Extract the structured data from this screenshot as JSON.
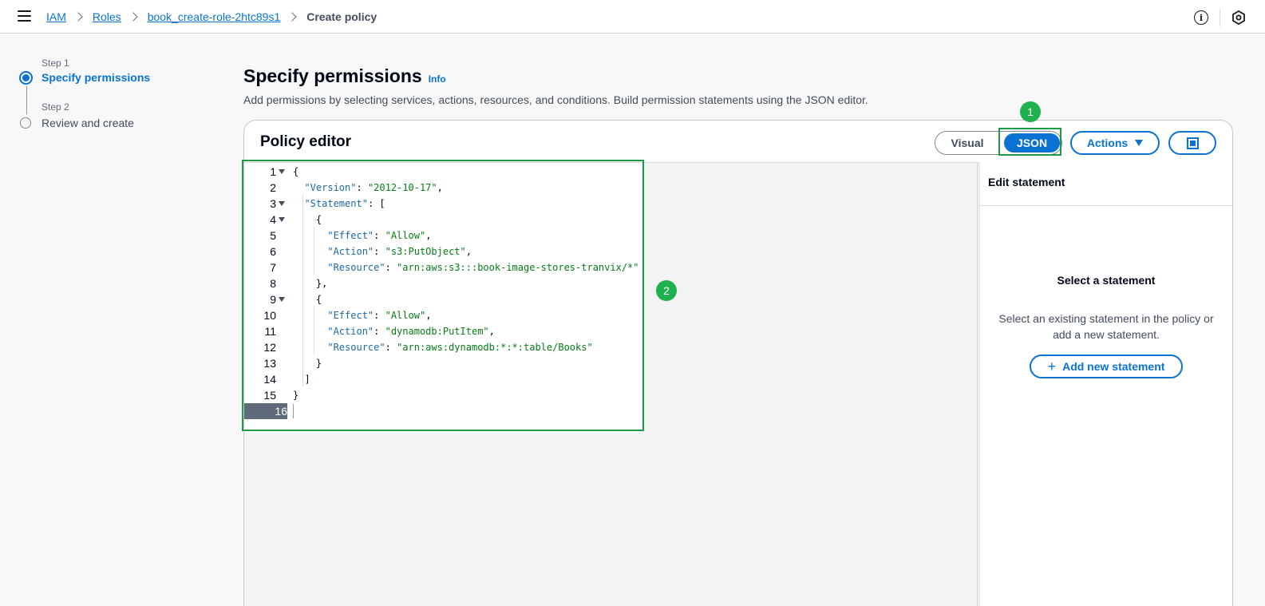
{
  "breadcrumb": {
    "items": [
      "IAM",
      "Roles",
      "book_create-role-2htc89s1"
    ],
    "current": "Create policy"
  },
  "steps": [
    {
      "number": "Step 1",
      "label": "Specify permissions"
    },
    {
      "number": "Step 2",
      "label": "Review and create"
    }
  ],
  "page": {
    "title": "Specify permissions",
    "info": "Info",
    "description": "Add permissions by selecting services, actions, resources, and conditions. Build permission statements using the JSON editor."
  },
  "editor": {
    "title": "Policy editor",
    "mode_visual": "Visual",
    "mode_json": "JSON",
    "actions_label": "Actions",
    "line_numbers": [
      "1",
      "2",
      "3",
      "4",
      "5",
      "6",
      "7",
      "8",
      "9",
      "10",
      "11",
      "12",
      "13",
      "14",
      "15",
      "16"
    ],
    "active_line": "16"
  },
  "policy": {
    "version_key": "\"Version\"",
    "version_val": "\"2012-10-17\"",
    "statement_key": "\"Statement\"",
    "effect_key": "\"Effect\"",
    "action_key": "\"Action\"",
    "resource_key": "\"Resource\"",
    "s1_effect": "\"Allow\"",
    "s1_action": "\"s3:PutObject\"",
    "s1_resource": "\"arn:aws:s3:::book-image-stores-tranvix/*\"",
    "s2_effect": "\"Allow\"",
    "s2_action": "\"dynamodb:PutItem\"",
    "s2_resource": "\"arn:aws:dynamodb:*:*:table/Books\""
  },
  "side_panel": {
    "header": "Edit statement",
    "title": "Select a statement",
    "description": "Select an existing statement in the policy or add a new statement.",
    "add_button": "Add new statement"
  },
  "annotations": {
    "one": "1",
    "two": "2"
  },
  "colors": {
    "accent": "#0972d3",
    "annotation": "#1fb04f"
  },
  "icons": [
    "menu-icon",
    "info-circle-icon",
    "hexagon-settings-icon",
    "caret-down-icon",
    "fullscreen-icon",
    "plus-icon",
    "fold-arrow-icon"
  ]
}
